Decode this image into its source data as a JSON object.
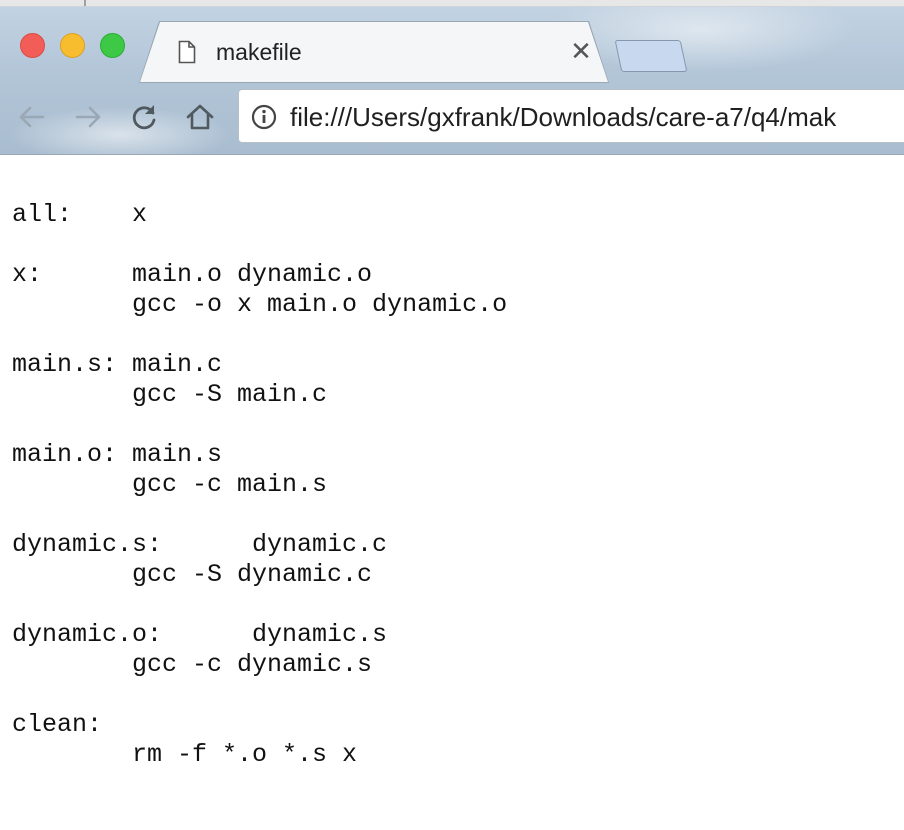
{
  "browser": {
    "tab": {
      "title": "makefile",
      "icon": "document-icon",
      "close_glyph": "✕"
    },
    "toolbar": {
      "back_icon": "back-arrow-icon",
      "forward_icon": "forward-arrow-icon",
      "reload_icon": "reload-icon",
      "home_icon": "home-icon"
    },
    "omnibox": {
      "security_icon": "info-icon",
      "url": "file:///Users/gxfrank/Downloads/care-a7/q4/mak"
    },
    "colors": {
      "traffic_red": "#f25e57",
      "traffic_yellow": "#f8bd2e",
      "traffic_green": "#3dc945"
    }
  },
  "document": {
    "lines": [
      "all:    x",
      "",
      "x:      main.o dynamic.o",
      "        gcc -o x main.o dynamic.o",
      "",
      "main.s: main.c",
      "        gcc -S main.c",
      "",
      "main.o: main.s",
      "        gcc -c main.s",
      "",
      "dynamic.s:      dynamic.c",
      "        gcc -S dynamic.c",
      "",
      "dynamic.o:      dynamic.s",
      "        gcc -c dynamic.s",
      "",
      "clean:",
      "        rm -f *.o *.s x"
    ]
  }
}
